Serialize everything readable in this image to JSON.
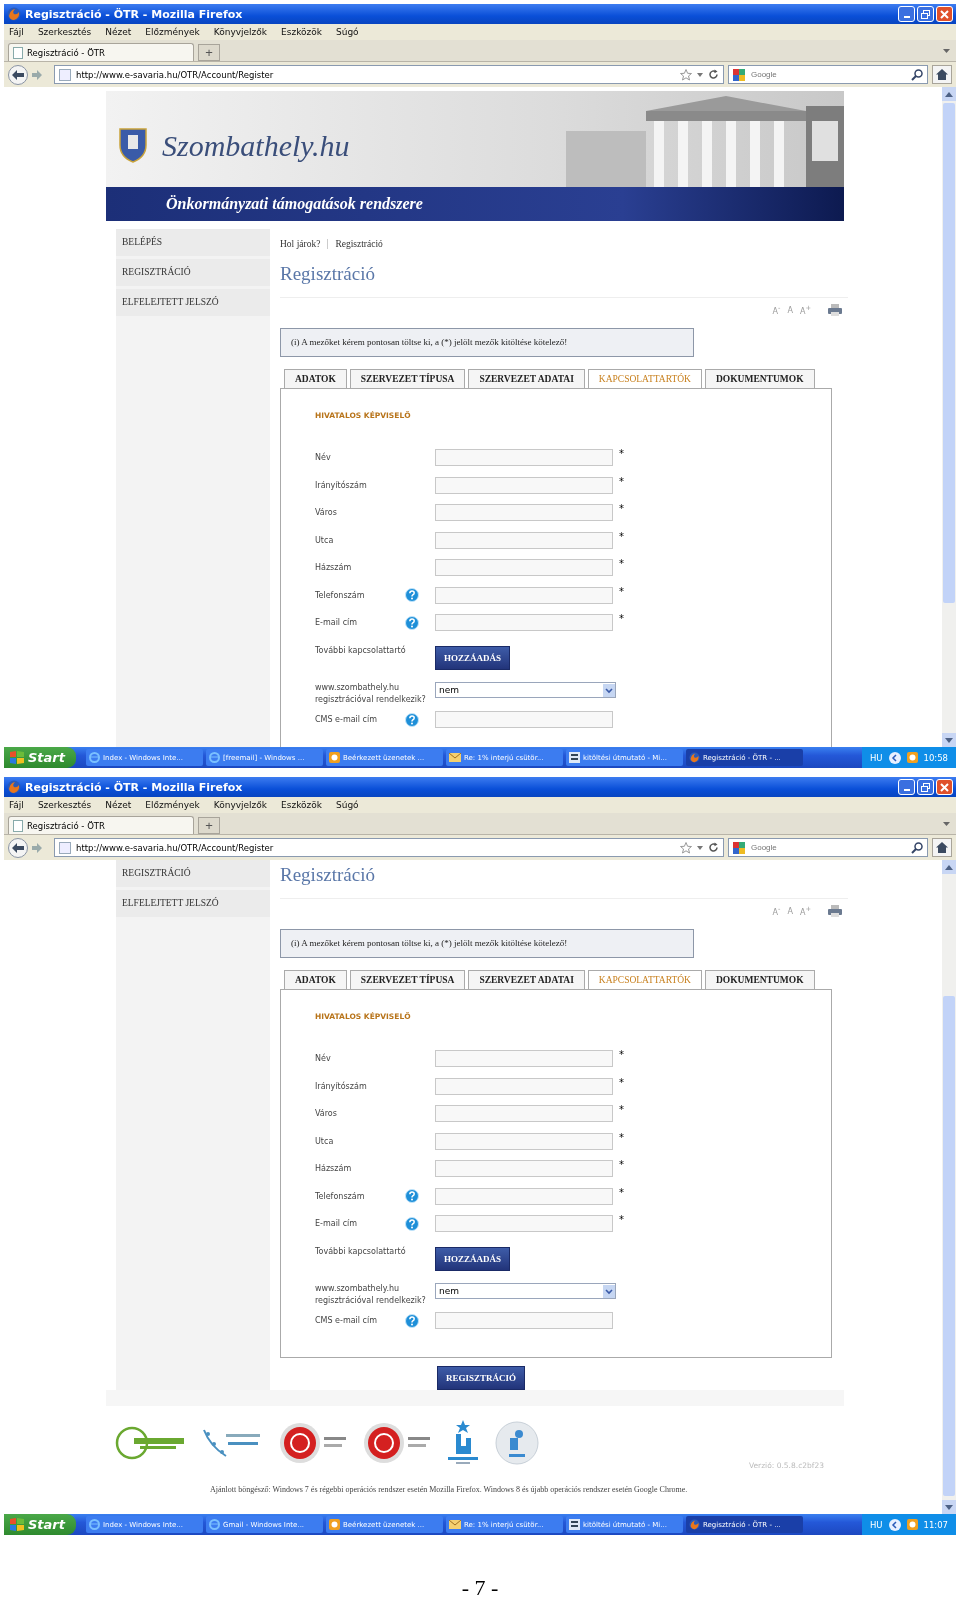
{
  "screenshots": [
    {
      "window": {
        "title": "Regisztráció - ÖTR - Mozilla Firefox"
      },
      "menu": [
        "Fájl",
        "Szerkesztés",
        "Nézet",
        "Előzmények",
        "Könyvjelzők",
        "Eszközök",
        "Súgó"
      ],
      "tab": {
        "label": "Regisztráció - ÖTR",
        "new_tab": "+"
      },
      "address": {
        "url": "http://www.e-savaria.hu/OTR/Account/Register",
        "search_placeholder": "Google"
      },
      "page": {
        "header": {
          "logo": "Szombathely.hu",
          "banner": "Önkormányzati támogatások rendszere"
        },
        "sidebar": [
          "BELÉPÉS",
          "REGISZTRÁCIÓ",
          "ELFELEJTETT JELSZÓ"
        ],
        "breadcrumb": {
          "label": "Hol járok?",
          "current": "Regisztráció"
        },
        "title": "Regisztráció",
        "font_size_controls": [
          "A$^{-}$",
          "A",
          "A$^{+}$"
        ],
        "notice": "(i) A mezőket kérem pontosan töltse ki, a (*) jelölt mezők kitöltése kötelező!",
        "tabs": [
          {
            "label": "ADATOK",
            "selected": false
          },
          {
            "label": "SZERVEZET TÍPUSA",
            "selected": false
          },
          {
            "label": "SZERVEZET ADATAI",
            "selected": false
          },
          {
            "label": "KAPCSOLATTARTÓK",
            "selected": true
          },
          {
            "label": "DOKUMENTUMOK",
            "selected": false
          }
        ],
        "section_title": "HIVATALOS KÉPVISELŐ",
        "fields": [
          {
            "kind": "text",
            "label": "Név",
            "help": false,
            "mark": "*"
          },
          {
            "kind": "text",
            "label": "Irányítószám",
            "help": false,
            "mark": "*"
          },
          {
            "kind": "text",
            "label": "Város",
            "help": false,
            "mark": "*"
          },
          {
            "kind": "text",
            "label": "Utca",
            "help": false,
            "mark": "*"
          },
          {
            "kind": "text",
            "label": "Házszám",
            "help": false,
            "mark": "*"
          },
          {
            "kind": "text",
            "label": "Telefonszám",
            "help": true,
            "mark": "*"
          },
          {
            "kind": "text",
            "label": "E-mail cím",
            "help": true,
            "mark": "*"
          },
          {
            "kind": "button",
            "label": "További kapcsolattartó",
            "button": "HOZZÁADÁS"
          },
          {
            "kind": "select",
            "label": "www.szombathely.hu regisztrációval rendelkezik?",
            "value": "nem"
          },
          {
            "kind": "text",
            "label": "CMS e-mail cím",
            "help": true
          }
        ]
      },
      "taskbar": {
        "start": "Start",
        "tasks": [
          {
            "label": "Index - Windows Inte...",
            "selected": false
          },
          {
            "label": "[freemail] - Windows ...",
            "selected": false
          },
          {
            "label": "Beérkezett üzenetek ...",
            "selected": false
          },
          {
            "label": "Re: 1% interjú csütör...",
            "selected": false
          },
          {
            "label": "kitöltési útmutató - Mi...",
            "selected": false
          },
          {
            "label": "Regisztráció - ÖTR - ...",
            "selected": true
          }
        ],
        "language": "HU",
        "clock": "10:58"
      }
    },
    {
      "window": {
        "title": "Regisztráció - ÖTR - Mozilla Firefox"
      },
      "menu": [
        "Fájl",
        "Szerkesztés",
        "Nézet",
        "Előzmények",
        "Könyvjelzők",
        "Eszközök",
        "Súgó"
      ],
      "tab": {
        "label": "Regisztráció - ÖTR",
        "new_tab": "+"
      },
      "address": {
        "url": "http://www.e-savaria.hu/OTR/Account/Register",
        "search_placeholder": "Google"
      },
      "page": {
        "sidebar": [
          "REGISZTRÁCIÓ",
          "ELFELEJTETT JELSZÓ"
        ],
        "title": "Regisztráció",
        "font_size_controls": [
          "A$^{-}$",
          "A",
          "A$^{+}$"
        ],
        "notice": "(i) A mezőket kérem pontosan töltse ki, a (*) jelölt mezők kitöltése kötelező!",
        "tabs": [
          {
            "label": "ADATOK",
            "selected": false
          },
          {
            "label": "SZERVEZET TÍPUSA",
            "selected": false
          },
          {
            "label": "SZERVEZET ADATAI",
            "selected": false
          },
          {
            "label": "KAPCSOLATTARTÓK",
            "selected": true
          },
          {
            "label": "DOKUMENTUMOK",
            "selected": false
          }
        ],
        "section_title": "HIVATALOS KÉPVISELŐ",
        "fields": [
          {
            "kind": "text",
            "label": "Név",
            "help": false,
            "mark": "*"
          },
          {
            "kind": "text",
            "label": "Irányítószám",
            "help": false,
            "mark": "*"
          },
          {
            "kind": "text",
            "label": "Város",
            "help": false,
            "mark": "*"
          },
          {
            "kind": "text",
            "label": "Utca",
            "help": false,
            "mark": "*"
          },
          {
            "kind": "text",
            "label": "Házszám",
            "help": false,
            "mark": "*"
          },
          {
            "kind": "text",
            "label": "Telefonszám",
            "help": true,
            "mark": "*"
          },
          {
            "kind": "text",
            "label": "E-mail cím",
            "help": true,
            "mark": "*"
          },
          {
            "kind": "button",
            "label": "További kapcsolattartó",
            "button": "HOZZÁADÁS"
          },
          {
            "kind": "select",
            "label": "www.szombathely.hu regisztrációval rendelkezik?",
            "value": "nem"
          },
          {
            "kind": "text",
            "label": "CMS e-mail cím",
            "help": true
          }
        ],
        "submit": "REGISZTRÁCIÓ",
        "footer": {
          "version": "Verzió: 0.5.8.c2bf23",
          "note": "Ajánlott böngésző: Windows 7 és régebbi operációs rendszer esetén Mozilla Firefox. Windows 8 és újabb operációs rendszer esetén Google Chrome."
        }
      },
      "taskbar": {
        "start": "Start",
        "tasks": [
          {
            "label": "Index - Windows Inte...",
            "selected": false
          },
          {
            "label": "Gmail - Windows Inte...",
            "selected": false
          },
          {
            "label": "Beérkezett üzenetek ...",
            "selected": false
          },
          {
            "label": "Re: 1% interjú csütör...",
            "selected": false
          },
          {
            "label": "kitöltési útmutató - Mi...",
            "selected": false
          },
          {
            "label": "Regisztráció - ÖTR - ...",
            "selected": true
          }
        ],
        "language": "HU",
        "clock": "11:07"
      }
    }
  ],
  "page_number": "- 7 -"
}
